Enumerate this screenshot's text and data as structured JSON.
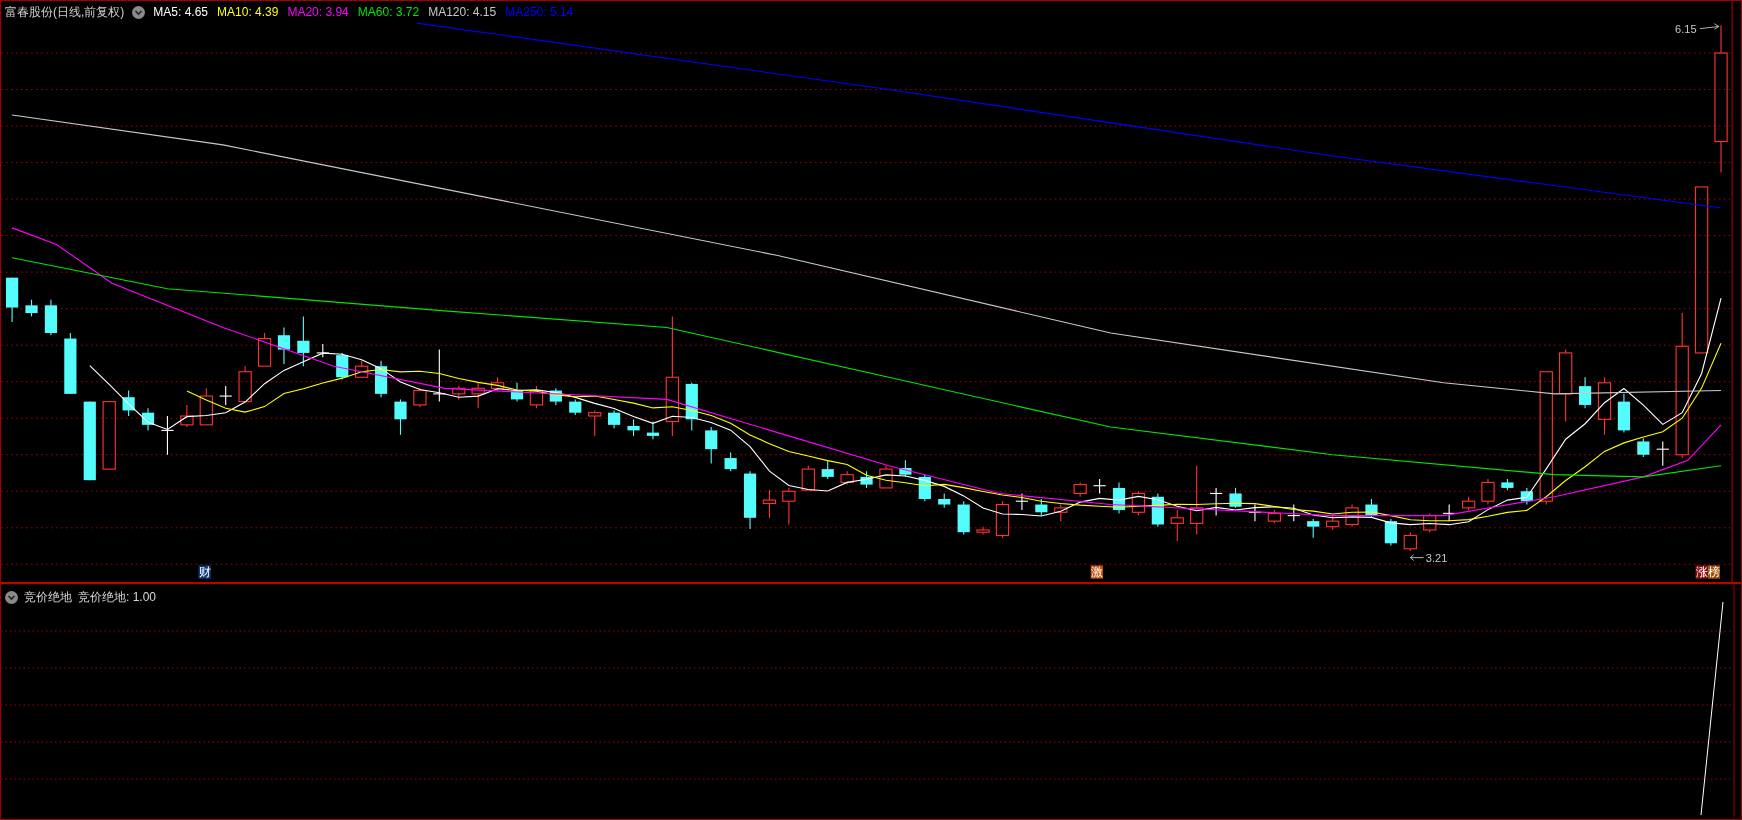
{
  "header": {
    "title": "富春股份(日线,前复权)",
    "moving_averages": [
      {
        "label": "MA5: 4.65",
        "color": "#ffffff"
      },
      {
        "label": "MA10: 4.39",
        "color": "#ffff00"
      },
      {
        "label": "MA20: 3.94",
        "color": "#ff00ff"
      },
      {
        "label": "MA60: 3.72",
        "color": "#00e600"
      },
      {
        "label": "MA120: 4.15",
        "color": "#c8c8c8"
      },
      {
        "label": "MA250: 5.14",
        "color": "#0000ff"
      }
    ]
  },
  "price_chart": {
    "high_label": "6.15",
    "low_label": "3.21",
    "markers": [
      {
        "text": "财",
        "color": "#0a3b78"
      },
      {
        "text": "激",
        "color": "#c8500a"
      },
      {
        "text": "涨",
        "color": "#8a1010"
      },
      {
        "text": "榜",
        "color": "#a0500a"
      }
    ]
  },
  "indicator_panel": {
    "title": "竞价绝地",
    "reading": "竞价绝地: 1.00"
  }
}
